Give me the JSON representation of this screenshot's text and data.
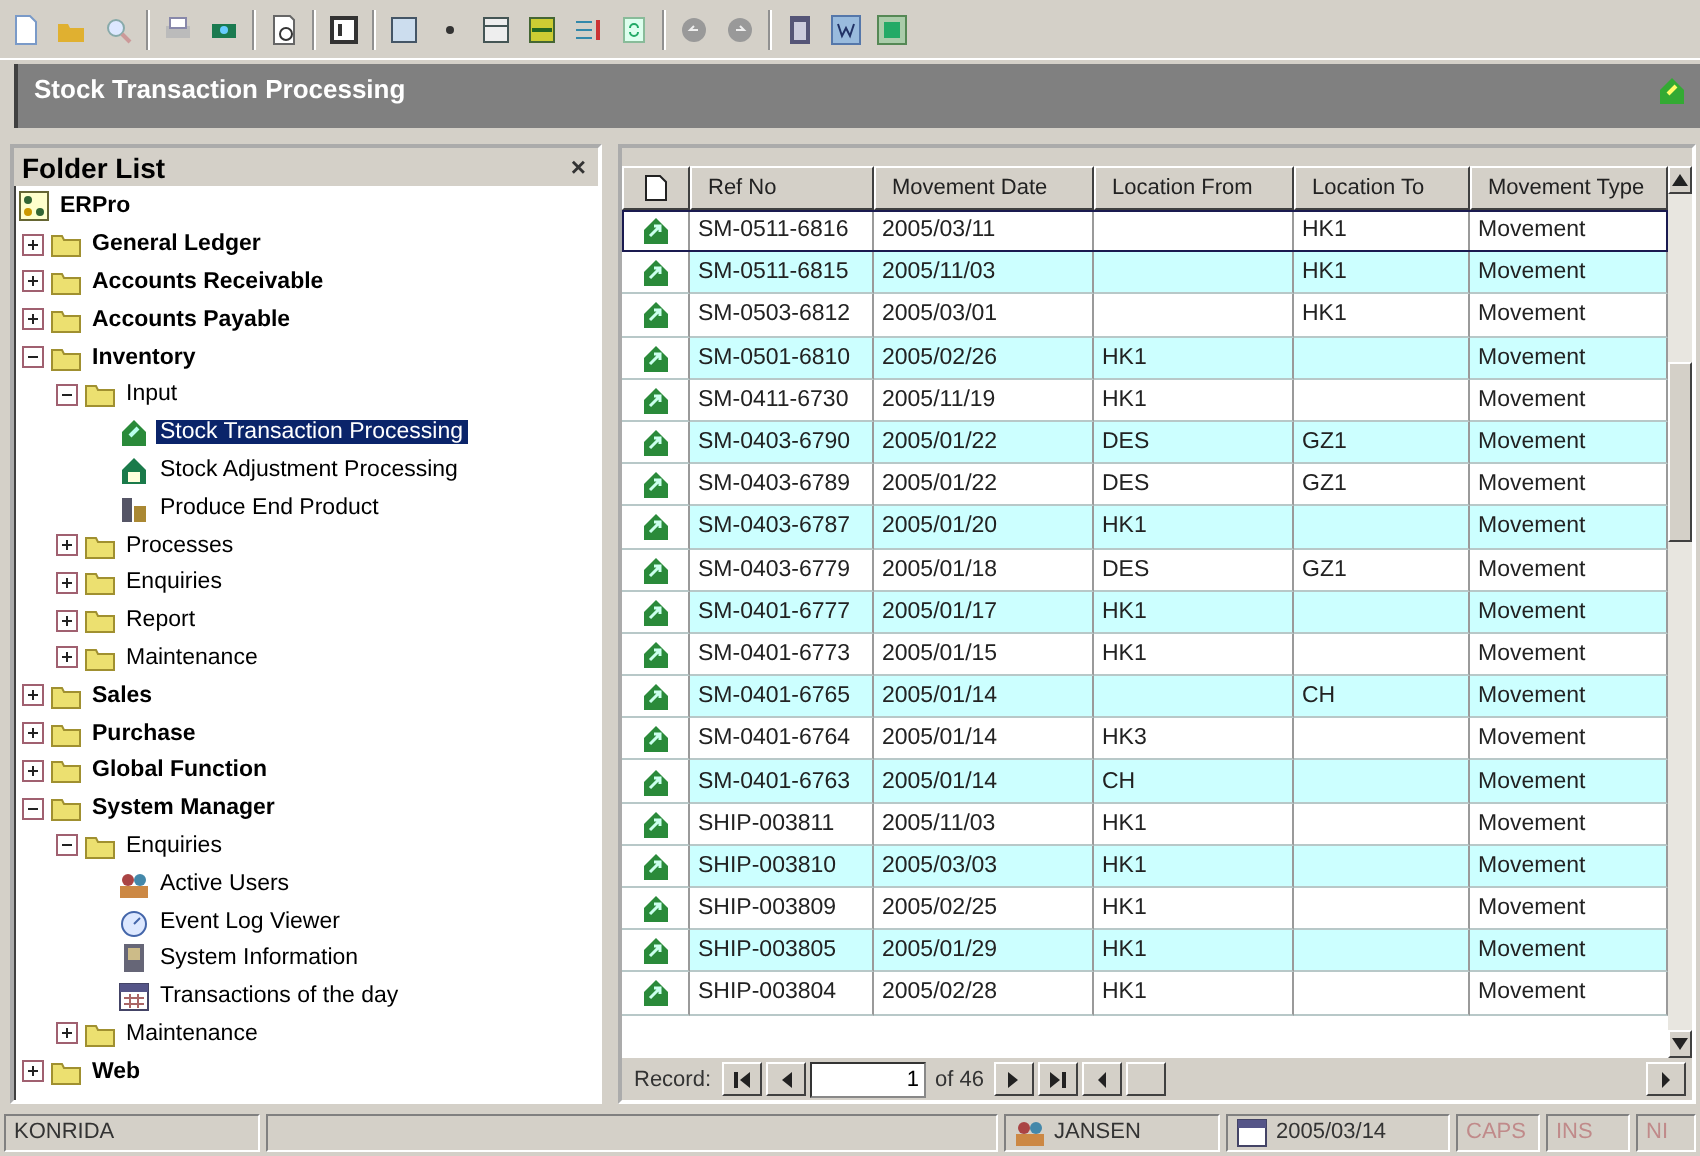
{
  "window": {
    "title": "Stock Transaction Processing"
  },
  "folder_list": {
    "title": "Folder List",
    "close": "×"
  },
  "tree": {
    "label": "ERPro",
    "kind": "root",
    "selected": false,
    "children": [
      {
        "label": "General Ledger",
        "kind": "folder",
        "expanded": false,
        "selected": false
      },
      {
        "label": "Accounts Receivable",
        "kind": "folder",
        "expanded": false,
        "selected": false
      },
      {
        "label": "Accounts Payable",
        "kind": "folder",
        "expanded": false,
        "selected": false
      },
      {
        "label": "Inventory",
        "kind": "folder",
        "expanded": true,
        "selected": false,
        "children": [
          {
            "label": "Input",
            "kind": "folder",
            "expanded": true,
            "selected": false,
            "children": [
              {
                "label": "Stock Transaction Processing",
                "kind": "task",
                "selected": true
              },
              {
                "label": "Stock Adjustment Processing",
                "kind": "adjust",
                "selected": false
              },
              {
                "label": "Produce End Product",
                "kind": "produce",
                "selected": false
              }
            ]
          },
          {
            "label": "Processes",
            "kind": "folder",
            "expanded": false,
            "selected": false
          },
          {
            "label": "Enquiries",
            "kind": "folder",
            "expanded": false,
            "selected": false
          },
          {
            "label": "Report",
            "kind": "folder",
            "expanded": false,
            "selected": false
          },
          {
            "label": "Maintenance",
            "kind": "folder",
            "expanded": false,
            "selected": false
          }
        ]
      },
      {
        "label": "Sales",
        "kind": "folder",
        "expanded": false,
        "selected": false
      },
      {
        "label": "Purchase",
        "kind": "folder",
        "expanded": false,
        "selected": false
      },
      {
        "label": "Global Function",
        "kind": "folder",
        "expanded": false,
        "selected": false
      },
      {
        "label": "System Manager",
        "kind": "folder",
        "expanded": true,
        "selected": false,
        "children": [
          {
            "label": "Enquiries",
            "kind": "folder",
            "expanded": true,
            "selected": false,
            "children": [
              {
                "label": "Active Users",
                "kind": "users",
                "selected": false
              },
              {
                "label": "Event Log Viewer",
                "kind": "log",
                "selected": false
              },
              {
                "label": "System Information",
                "kind": "info",
                "selected": false
              },
              {
                "label": "Transactions of the day",
                "kind": "calendar",
                "selected": false
              }
            ]
          },
          {
            "label": "Maintenance",
            "kind": "folder",
            "expanded": false,
            "selected": false
          }
        ]
      },
      {
        "label": "Web",
        "kind": "folder",
        "expanded": false,
        "selected": false
      }
    ]
  },
  "table": {
    "columns": [
      "Ref No",
      "Movement Date",
      "Location From",
      "Location To",
      "Movement Type"
    ],
    "rows": [
      {
        "ref": "SM-0511-6816",
        "date": "2005/03/11",
        "to": "HK1",
        "type": "Movement",
        "selected": true
      },
      {
        "ref": "SM-0511-6815",
        "date": "2005/11/03",
        "to": "HK1",
        "type": "Movement",
        "selected": false
      },
      {
        "ref": "SM-0503-6812",
        "date": "2005/03/01",
        "to": "HK1",
        "type": "Movement",
        "selected": false
      },
      {
        "ref": "SM-0501-6810",
        "date": "2005/02/26",
        "from": "HK1",
        "type": "Movement",
        "selected": false
      },
      {
        "ref": "SM-0411-6730",
        "date": "2005/11/19",
        "from": "HK1",
        "type": "Movement",
        "selected": false
      },
      {
        "ref": "SM-0403-6790",
        "date": "2005/01/22",
        "from": "DES",
        "to": "GZ1",
        "type": "Movement",
        "selected": false
      },
      {
        "ref": "SM-0403-6789",
        "date": "2005/01/22",
        "from": "DES",
        "to": "GZ1",
        "type": "Movement",
        "selected": false
      },
      {
        "ref": "SM-0403-6787",
        "date": "2005/01/20",
        "from": "HK1",
        "type": "Movement",
        "selected": false
      },
      {
        "ref": "SM-0403-6779",
        "date": "2005/01/18",
        "from": "DES",
        "to": "GZ1",
        "type": "Movement",
        "selected": false
      },
      {
        "ref": "SM-0401-6777",
        "date": "2005/01/17",
        "from": "HK1",
        "type": "Movement",
        "selected": false
      },
      {
        "ref": "SM-0401-6773",
        "date": "2005/01/15",
        "from": "HK1",
        "type": "Movement",
        "selected": false
      },
      {
        "ref": "SM-0401-6765",
        "date": "2005/01/14",
        "to": "CH",
        "type": "Movement",
        "selected": false
      },
      {
        "ref": "SM-0401-6764",
        "date": "2005/01/14",
        "from": "HK3",
        "type": "Movement",
        "selected": false
      },
      {
        "ref": "SM-0401-6763",
        "date": "2005/01/14",
        "from": "CH",
        "type": "Movement",
        "selected": false
      },
      {
        "ref": "SHIP-003811",
        "date": "2005/11/03",
        "from": "HK1",
        "type": "Movement",
        "selected": false
      },
      {
        "ref": "SHIP-003810",
        "date": "2005/03/03",
        "from": "HK1",
        "type": "Movement",
        "selected": false
      },
      {
        "ref": "SHIP-003809",
        "date": "2005/02/25",
        "from": "HK1",
        "type": "Movement",
        "selected": false
      },
      {
        "ref": "SHIP-003805",
        "date": "2005/01/29",
        "from": "HK1",
        "type": "Movement",
        "selected": false
      },
      {
        "ref": "SHIP-003804",
        "date": "2005/02/28",
        "from": "HK1",
        "type": "Movement",
        "selected": false
      }
    ]
  },
  "navigator": {
    "label": "Record:",
    "record": "1",
    "total": "of 46"
  },
  "status_bar": {
    "company": "KONRIDA",
    "user": "JANSEN",
    "date": "2005/03/14",
    "indicators": [
      {
        "label": "CAPS",
        "on": false
      },
      {
        "label": "INS",
        "on": false
      },
      {
        "label": "NI",
        "on": false
      }
    ]
  }
}
